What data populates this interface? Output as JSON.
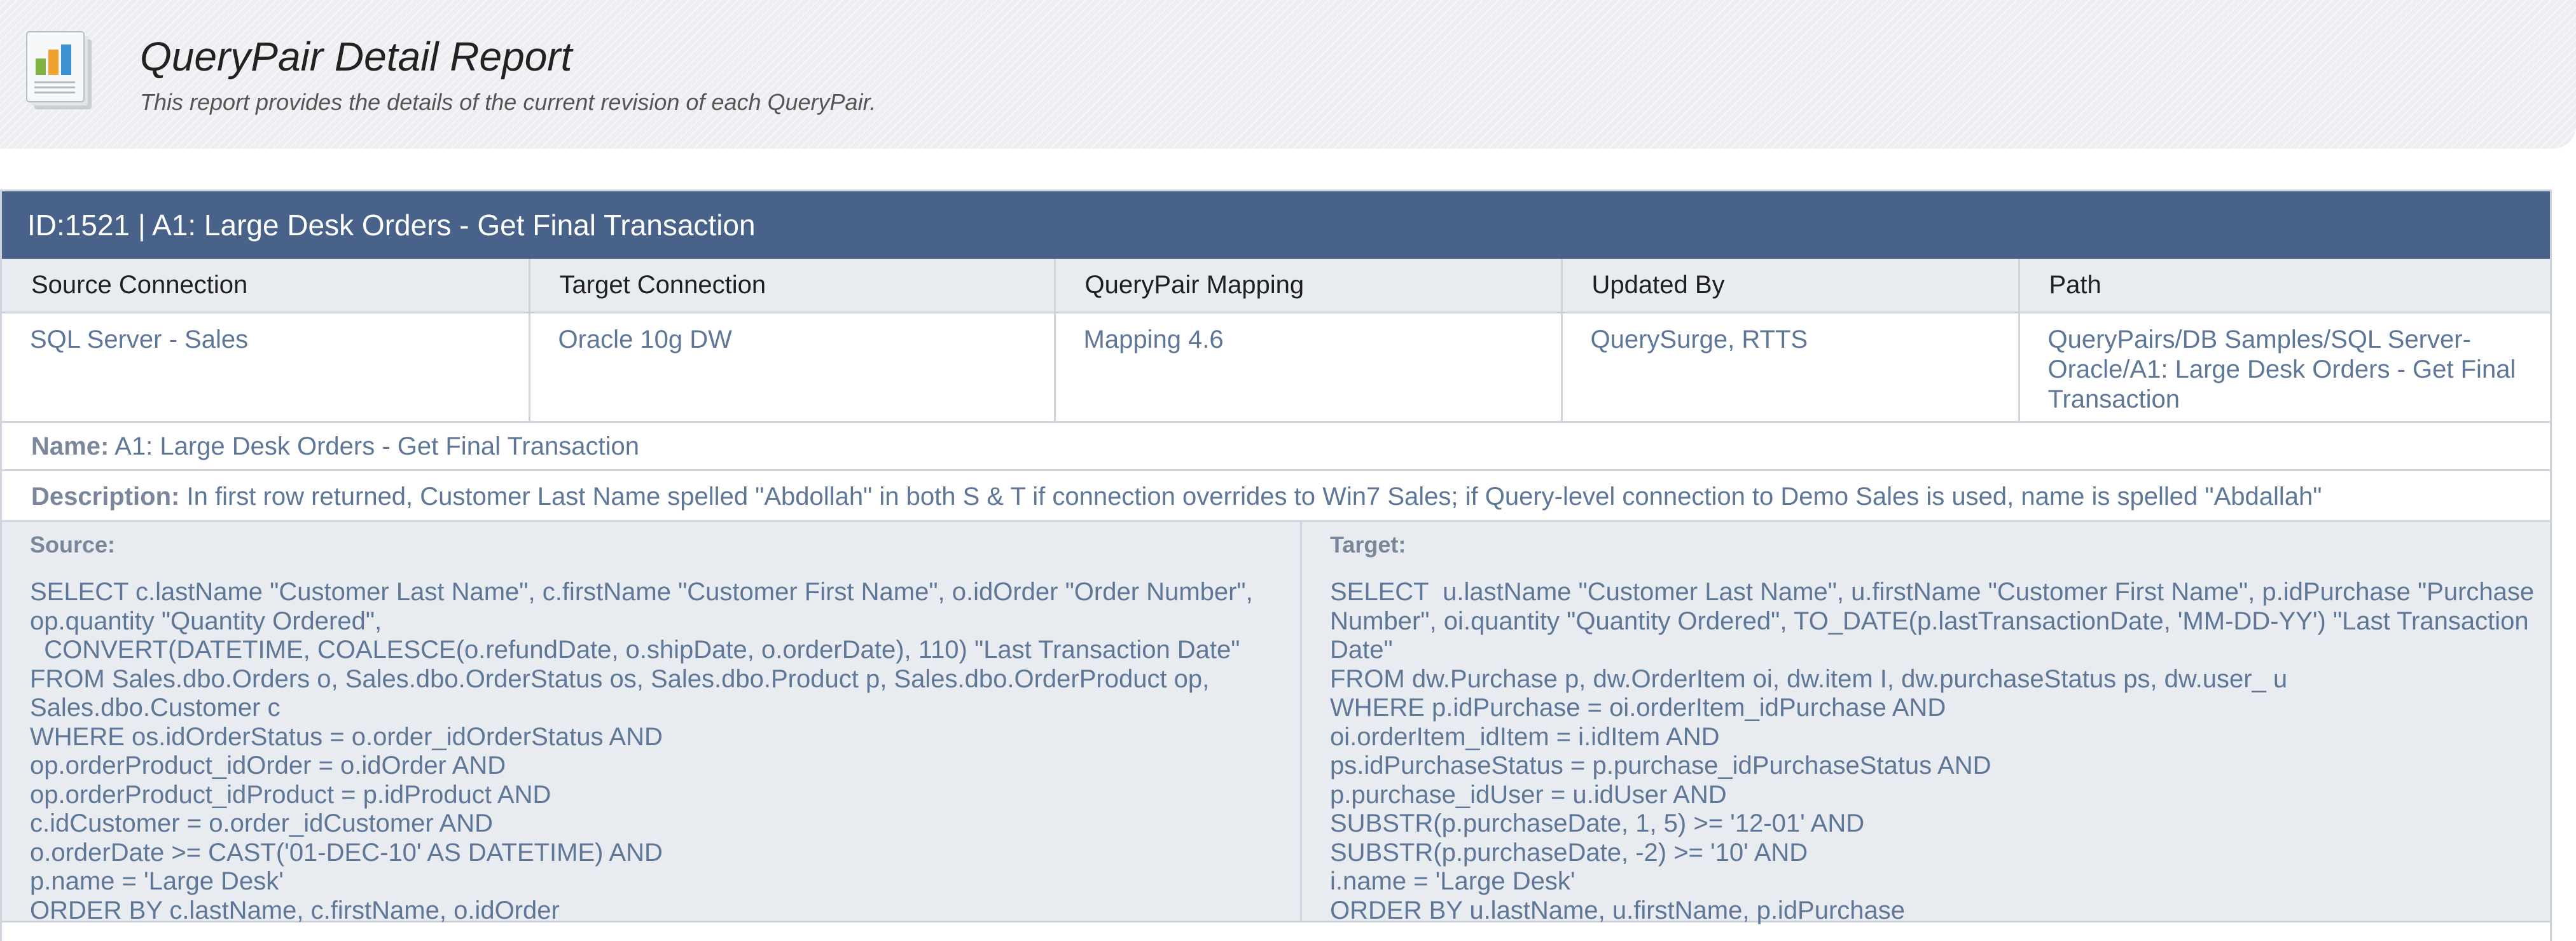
{
  "report": {
    "title": "QueryPair Detail Report",
    "subtitle": "This report provides the details of the current revision of each QueryPair.",
    "icon": "bar-chart-report-icon"
  },
  "querypair": {
    "header": "ID:1521 | A1: Large Desk Orders - Get Final Transaction",
    "columns": [
      "Source Connection",
      "Target Connection",
      "QueryPair Mapping",
      "Updated By",
      "Path"
    ],
    "values": [
      "SQL Server - Sales",
      "Oracle 10g DW",
      "Mapping 4.6",
      "QuerySurge, RTTS",
      "QueryPairs/DB Samples/SQL Server-Oracle/A1: Large Desk Orders - Get Final Transaction"
    ],
    "name_label": "Name:",
    "name_value": "A1: Large Desk Orders - Get Final Transaction",
    "description_label": "Description:",
    "description_value": "In first row returned, Customer Last Name spelled \"Abdollah\" in both S & T if connection overrides to Win7 Sales; if Query-level connection to Demo Sales is used, name is spelled \"Abdallah\"",
    "source_label": "Source:",
    "source_sql": "SELECT c.lastName \"Customer Last Name\", c.firstName \"Customer First Name\", o.idOrder \"Order Number\", op.quantity \"Quantity Ordered\",\n  CONVERT(DATETIME, COALESCE(o.refundDate, o.shipDate, o.orderDate), 110) \"Last Transaction Date\"\nFROM Sales.dbo.Orders o, Sales.dbo.OrderStatus os, Sales.dbo.Product p, Sales.dbo.OrderProduct op, Sales.dbo.Customer c\nWHERE os.idOrderStatus = o.order_idOrderStatus AND\nop.orderProduct_idOrder = o.idOrder AND\nop.orderProduct_idProduct = p.idProduct AND\nc.idCustomer = o.order_idCustomer AND\no.orderDate >= CAST('01-DEC-10' AS DATETIME) AND\np.name = 'Large Desk'\nORDER BY c.lastName, c.firstName, o.idOrder",
    "target_label": "Target:",
    "target_sql": "SELECT  u.lastName \"Customer Last Name\", u.firstName \"Customer First Name\", p.idPurchase \"Purchase Number\", oi.quantity \"Quantity Ordered\", TO_DATE(p.lastTransactionDate, 'MM-DD-YY') \"Last Transaction Date\"\nFROM dw.Purchase p, dw.OrderItem oi, dw.item I, dw.purchaseStatus ps, dw.user_ u\nWHERE p.idPurchase = oi.orderItem_idPurchase AND\noi.orderItem_idItem = i.idItem AND\nps.idPurchaseStatus = p.purchase_idPurchaseStatus AND\np.purchase_idUser = u.idUser AND\nSUBSTR(p.purchaseDate, 1, 5) >= '12-01' AND\nSUBSTR(p.purchaseDate, -2) >= '10' AND\ni.name = 'Large Desk'\nORDER BY u.lastName, u.firstName, p.idPurchase"
  },
  "colors": {
    "title_bar": "#48628a",
    "header_cell_bg": "#e8ebf0",
    "value_text": "#5f7797",
    "border": "#cfd3dd"
  }
}
